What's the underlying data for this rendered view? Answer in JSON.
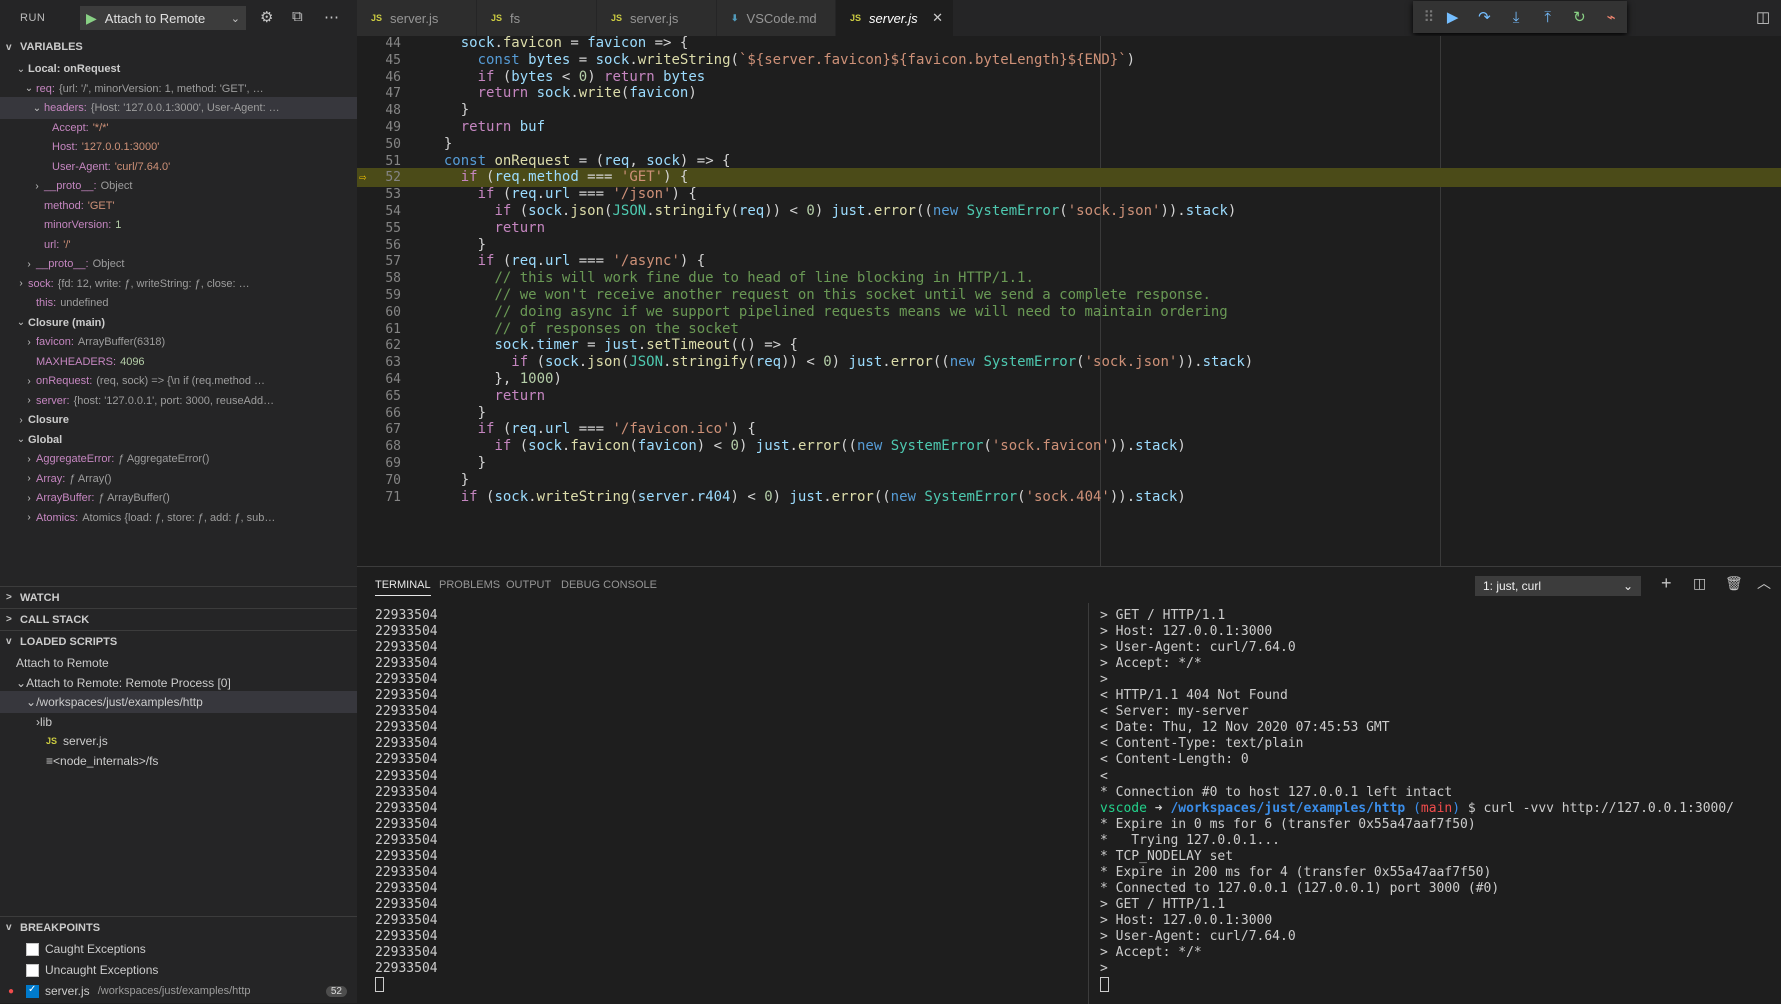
{
  "sidebar": {
    "run_label": "RUN",
    "config": "Attach to Remote",
    "variables_title": "VARIABLES",
    "variables": [
      {
        "indent": 1,
        "tw": "v",
        "key": "Local: onRequest",
        "scope": true
      },
      {
        "indent": 2,
        "tw": "v",
        "key": "req:",
        "val": "{url: '/', minorVersion: 1, method: 'GET', …",
        "cls": "vv"
      },
      {
        "indent": 3,
        "tw": "v",
        "key": "headers:",
        "val": "{Host: '127.0.0.1:3000', User-Agent: …",
        "cls": "vv",
        "selected": true
      },
      {
        "indent": 4,
        "tw": "",
        "key": "Accept:",
        "val": "'*/*'",
        "cls": "vs"
      },
      {
        "indent": 4,
        "tw": "",
        "key": "Host:",
        "val": "'127.0.0.1:3000'",
        "cls": "vs"
      },
      {
        "indent": 4,
        "tw": "",
        "key": "User-Agent:",
        "val": "'curl/7.64.0'",
        "cls": "vs"
      },
      {
        "indent": 3,
        "tw": ">",
        "key": "__proto__:",
        "val": "Object",
        "cls": "vv"
      },
      {
        "indent": 3,
        "tw": "",
        "key": "method:",
        "val": "'GET'",
        "cls": "vs"
      },
      {
        "indent": 3,
        "tw": "",
        "key": "minorVersion:",
        "val": "1",
        "cls": "vn"
      },
      {
        "indent": 3,
        "tw": "",
        "key": "url:",
        "val": "'/'",
        "cls": "vs"
      },
      {
        "indent": 2,
        "tw": ">",
        "key": "__proto__:",
        "val": "Object",
        "cls": "vv"
      },
      {
        "indent": 1,
        "tw": ">",
        "key": "sock:",
        "val": "{fd: 12, write: ƒ, writeString: ƒ, close: …",
        "cls": "vv"
      },
      {
        "indent": 2,
        "tw": "",
        "key": "this:",
        "val": "undefined",
        "cls": "vv"
      },
      {
        "indent": 1,
        "tw": "v",
        "key": "Closure (main)",
        "scope": true
      },
      {
        "indent": 2,
        "tw": ">",
        "key": "favicon:",
        "val": "ArrayBuffer(6318)",
        "cls": "vv"
      },
      {
        "indent": 2,
        "tw": "",
        "key": "MAXHEADERS:",
        "val": "4096",
        "cls": "vn"
      },
      {
        "indent": 2,
        "tw": ">",
        "key": "onRequest:",
        "val": "(req, sock) => {\\n    if (req.method …",
        "cls": "vv"
      },
      {
        "indent": 2,
        "tw": ">",
        "key": "server:",
        "val": "{host: '127.0.0.1', port: 3000, reuseAdd…",
        "cls": "vv"
      },
      {
        "indent": 1,
        "tw": ">",
        "key": "Closure",
        "scope": true
      },
      {
        "indent": 1,
        "tw": "v",
        "key": "Global",
        "scope": true
      },
      {
        "indent": 2,
        "tw": ">",
        "key": "AggregateError:",
        "val": "ƒ AggregateError()",
        "cls": "vv"
      },
      {
        "indent": 2,
        "tw": ">",
        "key": "Array:",
        "val": "ƒ Array()",
        "cls": "vv"
      },
      {
        "indent": 2,
        "tw": ">",
        "key": "ArrayBuffer:",
        "val": "ƒ ArrayBuffer()",
        "cls": "vv"
      },
      {
        "indent": 2,
        "tw": ">",
        "key": "Atomics:",
        "val": "Atomics {load: ƒ, store: ƒ, add: ƒ, sub…",
        "cls": "vv"
      }
    ],
    "watch_title": "WATCH",
    "callstack_title": "CALL STACK",
    "loaded_title": "LOADED SCRIPTS",
    "loaded": [
      {
        "indent": 1,
        "tw": "",
        "label": "Attach to Remote"
      },
      {
        "indent": 1,
        "tw": "v",
        "label": "Attach to Remote: Remote Process [0]"
      },
      {
        "indent": 2,
        "tw": "v",
        "label": "/workspaces/just/examples/http",
        "selected": true
      },
      {
        "indent": 3,
        "tw": ">",
        "label": "lib"
      },
      {
        "indent": 4,
        "tw": "",
        "label": "server.js",
        "js": true
      },
      {
        "indent": 4,
        "tw": "",
        "label": "<node_internals>/fs",
        "lines": true
      }
    ],
    "breakpoints_title": "BREAKPOINTS",
    "breakpoints": [
      {
        "label": "Caught Exceptions",
        "checked": false
      },
      {
        "label": "Uncaught Exceptions",
        "checked": false
      },
      {
        "label": "server.js",
        "path": "/workspaces/just/examples/http",
        "checked": true,
        "count": "52",
        "dot": true
      }
    ]
  },
  "tabs": [
    {
      "label": "server.js",
      "icon": "JS"
    },
    {
      "label": "fs",
      "icon": "JS"
    },
    {
      "label": "server.js",
      "icon": "JS"
    },
    {
      "label": "VSCode.md",
      "icon": "MD"
    },
    {
      "label": "server.js",
      "icon": "JS",
      "active": true
    }
  ],
  "editor": {
    "lines": [
      {
        "n": "44",
        "t": "    sock.favicon = favicon => {"
      },
      {
        "n": "45",
        "t": "      const bytes = sock.writeString(`${server.favicon}${favicon.byteLength}${END}`)"
      },
      {
        "n": "46",
        "t": "      if (bytes < 0) return bytes"
      },
      {
        "n": "47",
        "t": "      return sock.write(favicon)"
      },
      {
        "n": "48",
        "t": "    }"
      },
      {
        "n": "49",
        "t": "    return buf"
      },
      {
        "n": "50",
        "t": "  }"
      },
      {
        "n": "51",
        "t": "  const onRequest = (req, sock) => {"
      },
      {
        "n": "52",
        "t": "    if (req.method === 'GET') {",
        "hl": true
      },
      {
        "n": "53",
        "t": "      if (req.url === '/json') {"
      },
      {
        "n": "54",
        "t": "        if (sock.json(JSON.stringify(req)) < 0) just.error((new SystemError('sock.json')).stack)"
      },
      {
        "n": "55",
        "t": "        return"
      },
      {
        "n": "56",
        "t": "      }"
      },
      {
        "n": "57",
        "t": "      if (req.url === '/async') {"
      },
      {
        "n": "58",
        "t": "        // this will work fine due to head of line blocking in HTTP/1.1."
      },
      {
        "n": "59",
        "t": "        // we won't receive another request on this socket until we send a complete response."
      },
      {
        "n": "60",
        "t": "        // doing async if we support pipelined requests means we will need to maintain ordering"
      },
      {
        "n": "61",
        "t": "        // of responses on the socket"
      },
      {
        "n": "62",
        "t": "        sock.timer = just.setTimeout(() => {"
      },
      {
        "n": "63",
        "t": "          if (sock.json(JSON.stringify(req)) < 0) just.error((new SystemError('sock.json')).stack)"
      },
      {
        "n": "64",
        "t": "        }, 1000)"
      },
      {
        "n": "65",
        "t": "        return"
      },
      {
        "n": "66",
        "t": "      }"
      },
      {
        "n": "67",
        "t": "      if (req.url === '/favicon.ico') {"
      },
      {
        "n": "68",
        "t": "        if (sock.favicon(favicon) < 0) just.error((new SystemError('sock.favicon')).stack)"
      },
      {
        "n": "69",
        "t": "      }"
      },
      {
        "n": "70",
        "t": "    }"
      },
      {
        "n": "71",
        "t": "    if (sock.writeString(server.r404) < 0) just.error((new SystemError('sock.404')).stack)"
      }
    ]
  },
  "panel": {
    "tabs": [
      "TERMINAL",
      "PROBLEMS",
      "OUTPUT",
      "DEBUG CONSOLE"
    ],
    "terminal_select": "1: just, curl",
    "left_lines": [
      "22933504",
      "22933504",
      "22933504",
      "22933504",
      "22933504",
      "22933504",
      "22933504",
      "22933504",
      "22933504",
      "22933504",
      "22933504",
      "22933504",
      "22933504",
      "22933504",
      "22933504",
      "22933504",
      "22933504",
      "22933504",
      "22933504",
      "22933504",
      "22933504",
      "22933504",
      "22933504"
    ],
    "right_lines": [
      "> GET / HTTP/1.1",
      "> Host: 127.0.0.1:3000",
      "> User-Agent: curl/7.64.0",
      "> Accept: */*",
      ">",
      "< HTTP/1.1 404 Not Found",
      "< Server: my-server",
      "< Date: Thu, 12 Nov 2020 07:45:53 GMT",
      "< Content-Type: text/plain",
      "< Content-Length: 0",
      "<",
      "* Connection #0 to host 127.0.0.1 left intact",
      "",
      "* Expire in 0 ms for 6 (transfer 0x55a47aaf7f50)",
      "*   Trying 127.0.0.1...",
      "* TCP_NODELAY set",
      "* Expire in 200 ms for 4 (transfer 0x55a47aaf7f50)",
      "* Connected to 127.0.0.1 (127.0.0.1) port 3000 (#0)",
      "> GET / HTTP/1.1",
      "> Host: 127.0.0.1:3000",
      "> User-Agent: curl/7.64.0",
      "> Accept: */*",
      ">"
    ],
    "prompt": {
      "user": "vscode",
      "arrow": "➜",
      "path": "/workspaces/just/examples/http",
      "branch": "main",
      "cmd": "$ curl -vvv http://127.0.0.1:3000/"
    }
  },
  "colors": {
    "accent": "#007acc",
    "highlight_line": "#4b4b18",
    "breakpoint": "#f14c4c",
    "current_arrow": "#ffcc00"
  }
}
